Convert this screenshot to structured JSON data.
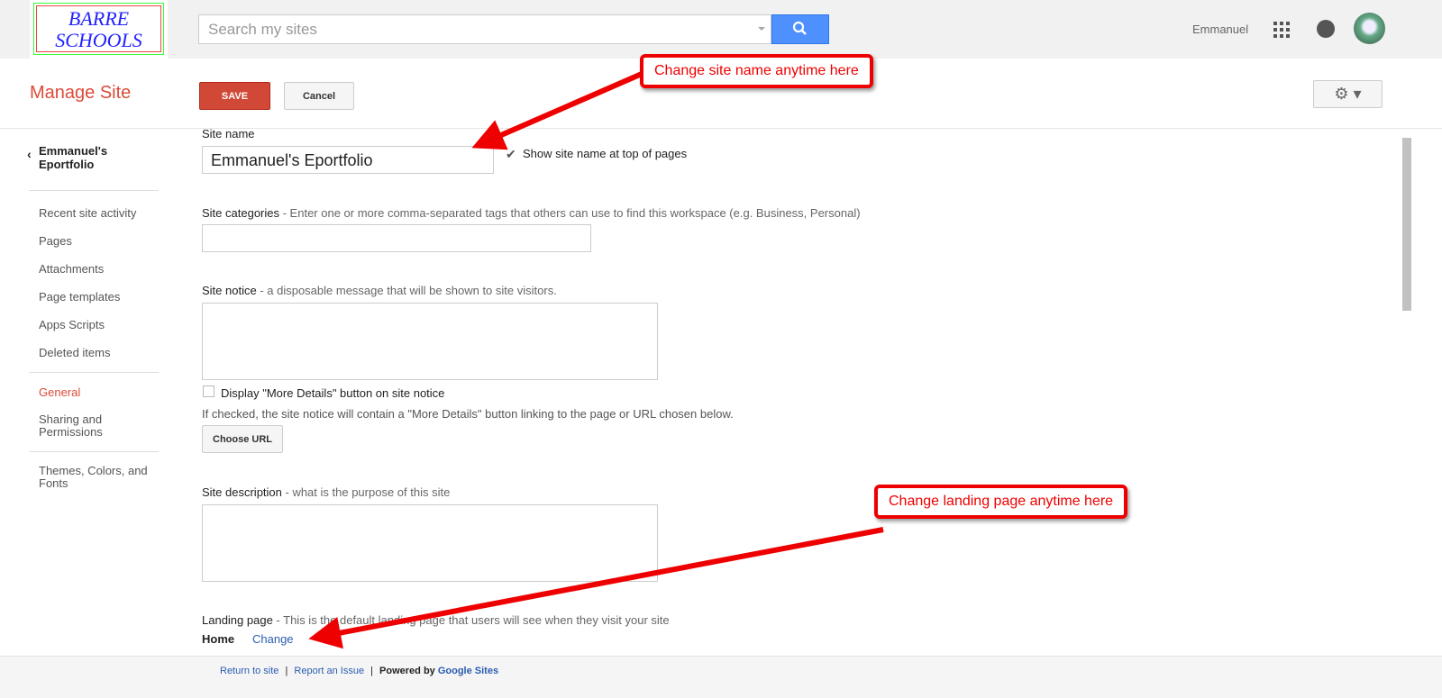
{
  "logo": {
    "line1": "BARRE",
    "line2": "SCHOOLS"
  },
  "search": {
    "placeholder": "Search my sites"
  },
  "user": {
    "name": "Emmanuel"
  },
  "header": {
    "title": "Manage Site",
    "save": "SAVE",
    "cancel": "Cancel"
  },
  "sidebar": {
    "site": "Emmanuel's Eportfolio",
    "items": [
      "Recent site activity",
      "Pages",
      "Attachments",
      "Page templates",
      "Apps Scripts",
      "Deleted items"
    ],
    "general": "General",
    "sharing": "Sharing and Permissions",
    "themes": "Themes, Colors, and Fonts"
  },
  "form": {
    "site_name_label": "Site name",
    "site_name_value": "Emmanuel's Eportfolio",
    "show_name": "Show site name at top of pages",
    "categories_label": "Site categories",
    "categories_desc": " - Enter one or more comma-separated tags that others can use to find this workspace (e.g. Business, Personal)",
    "notice_label": "Site notice",
    "notice_desc": " - a disposable message that will be shown to site visitors.",
    "more_details": "Display \"More Details\" button on site notice",
    "more_details_help": "If checked, the site notice will contain a \"More Details\" button linking to the page or URL chosen below.",
    "choose_url": "Choose URL",
    "desc_label": "Site description",
    "desc_desc": " - what is the purpose of this site",
    "landing_label": "Landing page",
    "landing_desc": " - This is the default landing page that users will see when they visit your site",
    "landing_value": "Home",
    "change": "Change"
  },
  "footer": {
    "return": "Return to site",
    "report": "Report an Issue",
    "powered": "Powered by ",
    "google_sites": "Google Sites"
  },
  "callouts": {
    "name": "Change site name anytime here",
    "landing": "Change landing page anytime here"
  }
}
